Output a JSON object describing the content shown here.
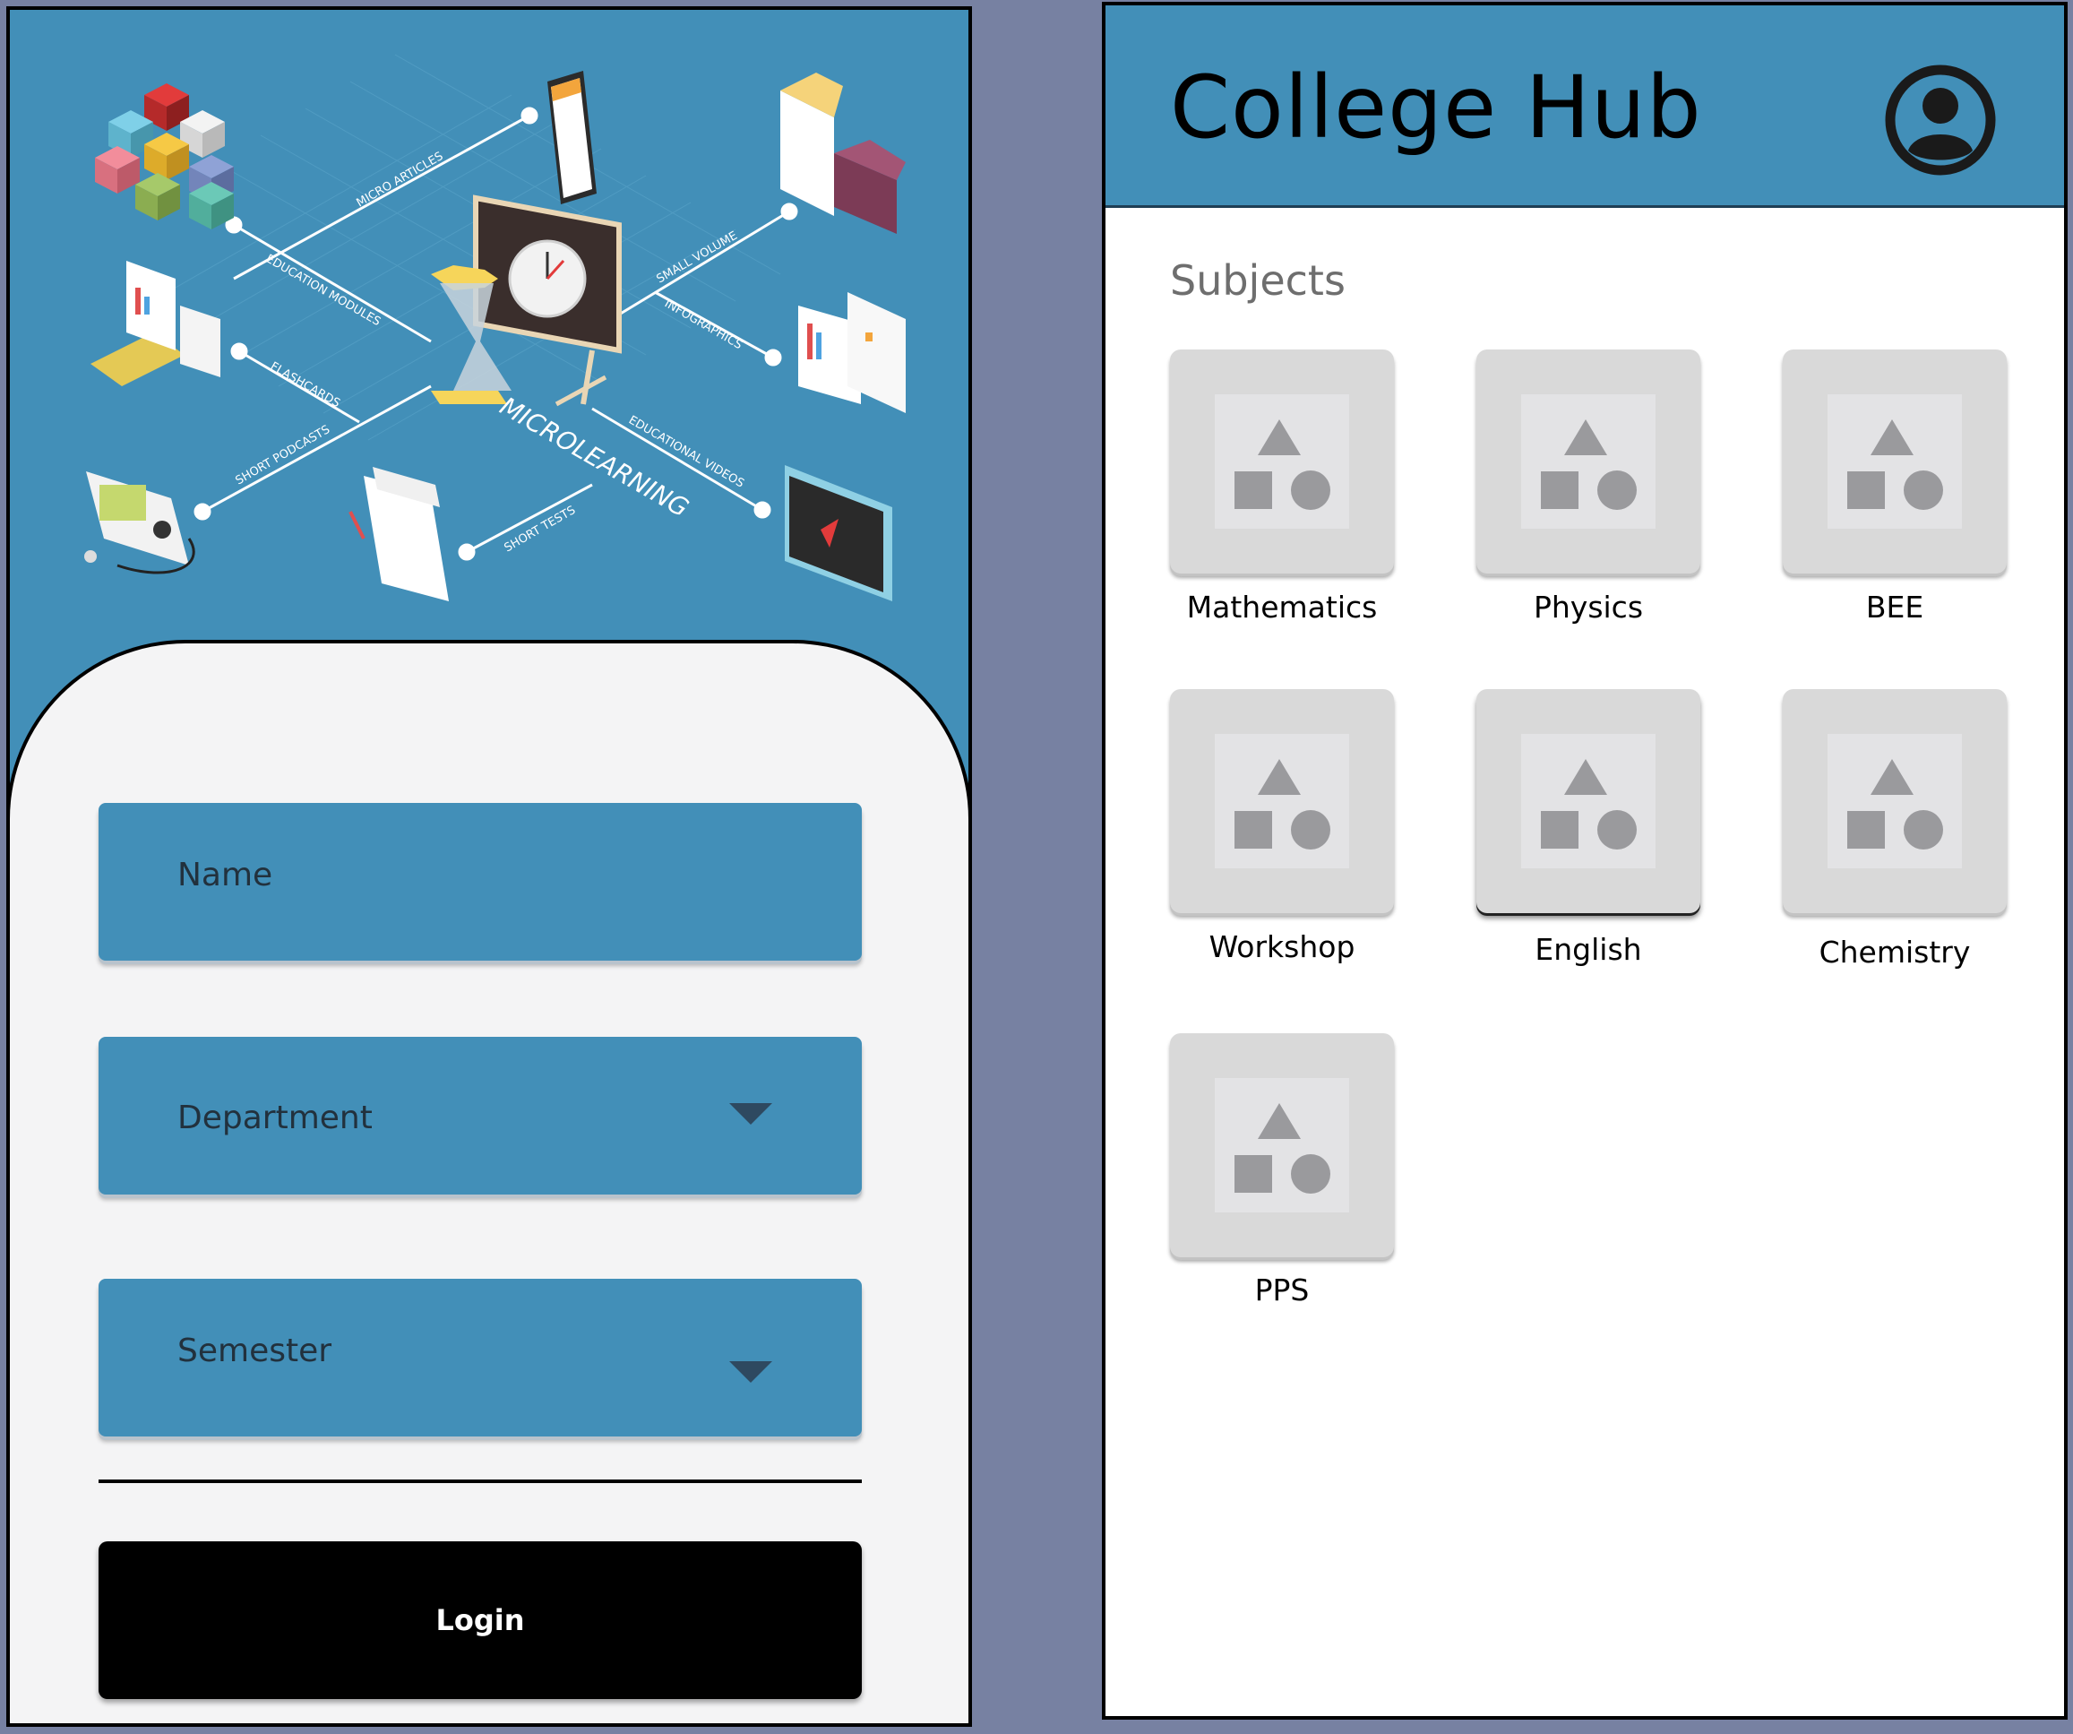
{
  "login": {
    "hero": {
      "center_label": "MICROLEARNING",
      "labels": [
        "MICRO ARTICLES",
        "EDUCATION MODULES",
        "FLASHCARDS",
        "SHORT PODCASTS",
        "SHORT TESTS",
        "EDUCATIONAL VIDEOS",
        "INFOGRAPHICS",
        "SMALL VOLUME"
      ]
    },
    "fields": {
      "name_placeholder": "Name",
      "department_label": "Department",
      "semester_label": "Semester"
    },
    "login_label": "Login"
  },
  "hub": {
    "title": "College Hub",
    "section_title": "Subjects",
    "subjects": [
      {
        "label": "Mathematics"
      },
      {
        "label": "Physics"
      },
      {
        "label": "BEE"
      },
      {
        "label": "Workshop"
      },
      {
        "label": "English"
      },
      {
        "label": "Chemistry"
      },
      {
        "label": "PPS"
      }
    ]
  },
  "colors": {
    "accent_blue": "#428fb8",
    "background": "#7781a2",
    "sheet": "#f4f4f5",
    "button": "#000000"
  }
}
